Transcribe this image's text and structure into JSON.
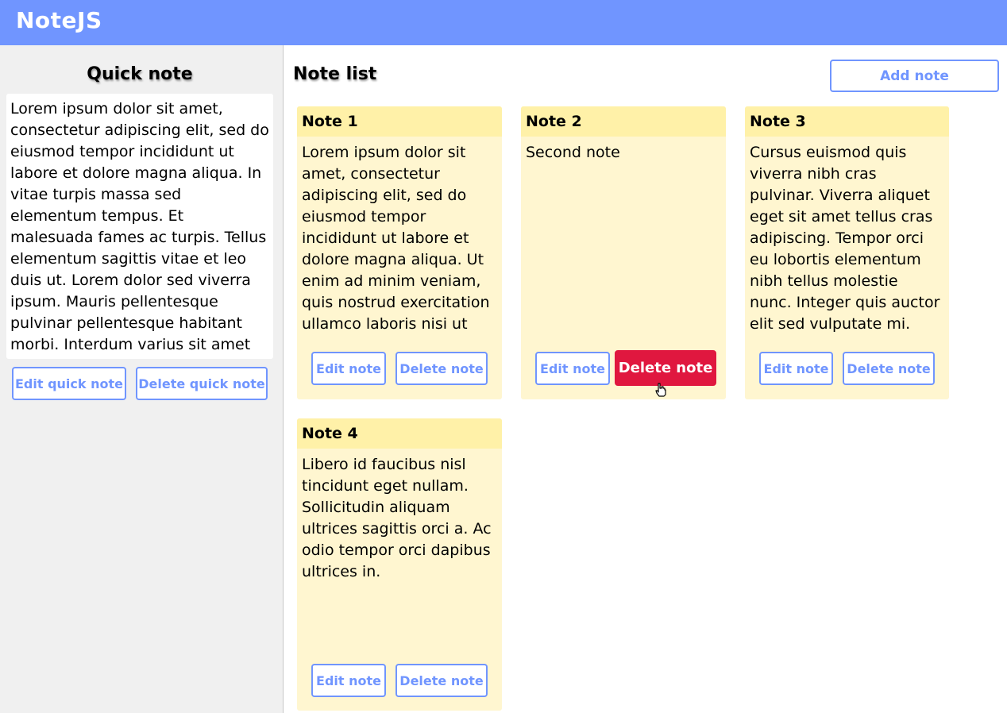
{
  "app": {
    "title": "NoteJS"
  },
  "sidebar": {
    "title": "Quick note",
    "text": "Lorem ipsum dolor sit amet, consectetur adipiscing elit, sed do eiusmod tempor incididunt ut labore et dolore magna aliqua. In vitae turpis massa sed elementum tempus. Et malesuada fames ac turpis. Tellus elementum sagittis vitae et leo duis ut. Lorem dolor sed viverra ipsum. Mauris pellentesque pulvinar pellentesque habitant morbi. Interdum varius sit amet mattis vulputate enim.",
    "edit_label": "Edit quick note",
    "delete_label": "Delete quick note"
  },
  "main": {
    "title": "Note list",
    "add_label": "Add note"
  },
  "notes": [
    {
      "title": "Note 1",
      "text": "Lorem ipsum dolor sit amet, consectetur adipiscing elit, sed do eiusmod tempor incididunt ut labore et dolore magna aliqua. Ut enim ad minim veniam, quis nostrud exercitation ullamco laboris nisi ut",
      "edit_label": "Edit note",
      "delete_label": "Delete note"
    },
    {
      "title": "Note 2",
      "text": "Second note",
      "edit_label": "Edit note",
      "delete_label": "Delete note"
    },
    {
      "title": "Note 3",
      "text": "Cursus euismod quis viverra nibh cras pulvinar. Viverra aliquet eget sit amet tellus cras adipiscing. Tempor orci eu lobortis elementum nibh tellus molestie nunc. Integer quis auctor elit sed vulputate mi. Molestie",
      "edit_label": "Edit note",
      "delete_label": "Delete note"
    },
    {
      "title": "Note 4",
      "text": "Libero id faucibus nisl tincidunt eget nullam. Sollicitudin aliquam ultrices sagittis orci a. Ac odio tempor orci dapibus ultrices in.",
      "edit_label": "Edit note",
      "delete_label": "Delete note"
    }
  ],
  "colors": {
    "header": "#7095ff",
    "accent": "#7095ff",
    "danger": "#e0173f",
    "note_body": "#fff6d0",
    "note_header": "#fff1a8",
    "sidebar_bg": "#f0f0f0"
  },
  "icons": {
    "cursor": "hand-pointer-icon"
  }
}
